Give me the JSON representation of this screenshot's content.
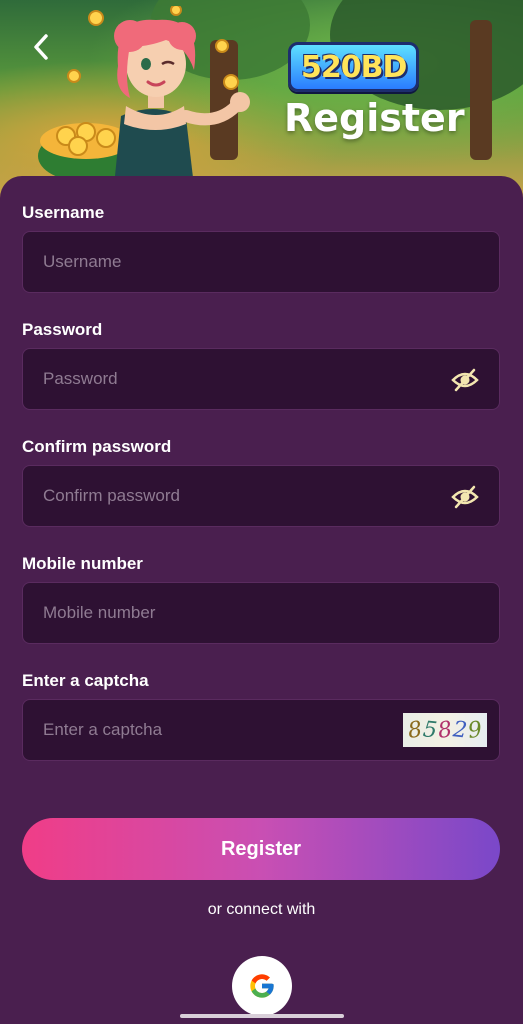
{
  "header": {
    "logo_text": "520BD",
    "title": "Register"
  },
  "form": {
    "username": {
      "label": "Username",
      "placeholder": "Username",
      "value": ""
    },
    "password": {
      "label": "Password",
      "placeholder": "Password",
      "value": ""
    },
    "confirm_password": {
      "label": "Confirm password",
      "placeholder": "Confirm password",
      "value": ""
    },
    "mobile": {
      "label": "Mobile number",
      "placeholder": "Mobile number",
      "value": ""
    },
    "captcha": {
      "label": "Enter a captcha",
      "placeholder": "Enter a captcha",
      "value": "",
      "code": "85829"
    }
  },
  "actions": {
    "register_label": "Register",
    "connect_text": "or connect with"
  },
  "icons": {
    "back": "chevron-left-icon",
    "eye_hidden": "eye-off-icon",
    "google": "google-icon"
  },
  "colors": {
    "card": "#4a1f4f",
    "input_bg": "#2e1133",
    "button_start": "#f03d87",
    "button_end": "#7a48c9",
    "eye_icon": "#f3e6b0"
  }
}
